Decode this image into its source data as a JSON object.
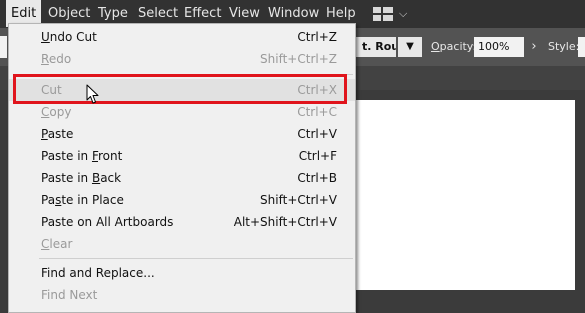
{
  "menubar": {
    "items": [
      {
        "label": "Edit",
        "active": true
      },
      {
        "label": "Object"
      },
      {
        "label": "Type"
      },
      {
        "label": "Select"
      },
      {
        "label": "Effect"
      },
      {
        "label": "View"
      },
      {
        "label": "Window"
      },
      {
        "label": "Help"
      }
    ],
    "workspace_icon": "workspace-layout-icon",
    "workspace_caret": "chevron-down-icon"
  },
  "controlbar": {
    "brush_value": "t. Round",
    "opacity_label_accel": "O",
    "opacity_label_rest": "pacity:",
    "opacity_value": "100%",
    "style_label": "Style:"
  },
  "edit_menu": {
    "items": [
      {
        "accel": "U",
        "rest": "ndo Cut",
        "shortcut": "Ctrl+Z",
        "enabled": true
      },
      {
        "accel": "R",
        "rest": "edo",
        "shortcut": "Shift+Ctrl+Z",
        "enabled": false
      },
      {
        "accel": "",
        "rest": "Cut",
        "shortcut": "Ctrl+X",
        "enabled": false
      },
      {
        "accel": "C",
        "rest": "opy",
        "shortcut": "Ctrl+C",
        "enabled": false
      },
      {
        "accel": "P",
        "rest": "aste",
        "shortcut": "Ctrl+V",
        "enabled": true
      },
      {
        "pre": "Paste in ",
        "accel": "F",
        "rest": "ront",
        "shortcut": "Ctrl+F",
        "enabled": true
      },
      {
        "pre": "Paste in ",
        "accel": "B",
        "rest": "ack",
        "shortcut": "Ctrl+B",
        "enabled": true
      },
      {
        "pre": "Pa",
        "accel": "s",
        "rest": "te in Place",
        "shortcut": "Shift+Ctrl+V",
        "enabled": true
      },
      {
        "pre": "Paste on All Artboards",
        "accel": "",
        "rest": "",
        "shortcut": "Alt+Shift+Ctrl+V",
        "enabled": true
      },
      {
        "accel": "C",
        "rest": "lear",
        "shortcut": "",
        "enabled": false
      },
      {
        "pre": "Find and Replace...",
        "accel": "",
        "rest": "",
        "shortcut": "",
        "enabled": true
      },
      {
        "pre": "Find Next",
        "accel": "",
        "rest": "",
        "shortcut": "",
        "enabled": false
      }
    ],
    "hovered_item": "Cut"
  },
  "colors": {
    "highlight_border": "#e0141c",
    "menubar_bg": "#323232",
    "menu_bg": "#f0f0f0",
    "disabled_text": "#9a9a9a"
  }
}
